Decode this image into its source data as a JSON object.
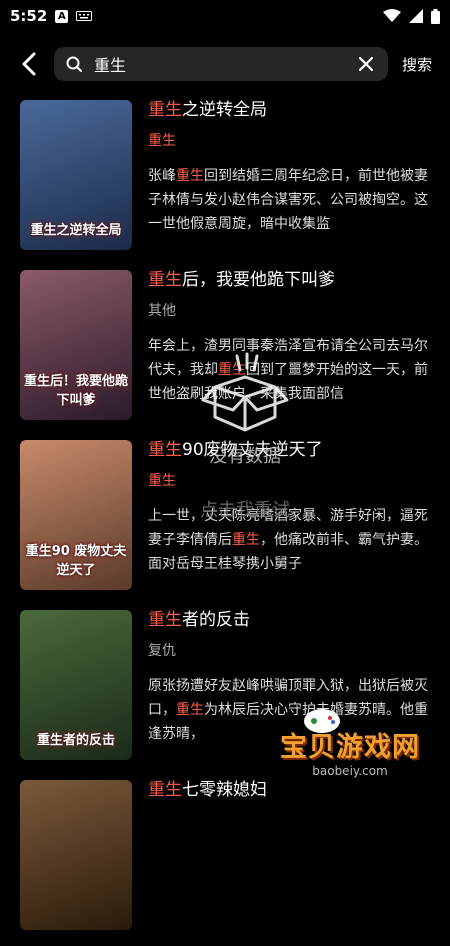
{
  "status_bar": {
    "time": "5:52",
    "icon_a": "A"
  },
  "header": {
    "search_value": "重生",
    "search_button": "搜索"
  },
  "results": [
    {
      "title_hl": "重生",
      "title_rest": "之逆转全局",
      "tag": "重生",
      "tag_red": true,
      "desc_pre": "张峰",
      "desc_hl": "重生",
      "desc_post": "回到结婚三周年纪念日，前世他被妻子林倩与发小赵伟合谋害死、公司被掏空。这一世他假意周旋，暗中收集监",
      "cover_text": "重生之逆转全局",
      "cover_colors": [
        "#4a6a9a",
        "#1a2a4a"
      ]
    },
    {
      "title_hl": "重生",
      "title_rest": "后，我要他跪下叫爹",
      "tag": "其他",
      "tag_red": false,
      "desc_pre": "年会上，渣男同事秦浩泽宣布请全公司去马尔代夫，我却",
      "desc_hl": "重生",
      "desc_post": "回到了噩梦开始的这一天，前世他盗刷我账户、采集我面部信",
      "cover_text": "重生后！我要他跪下叫爹",
      "cover_colors": [
        "#8a5a6a",
        "#2a1a2a"
      ]
    },
    {
      "title_hl": "重生",
      "title_rest": "90废物丈夫逆天了",
      "tag": "重生",
      "tag_red": true,
      "desc_pre": "上一世，丈夫陈亮嗜酒家暴、游手好闲，逼死妻子李倩倩后",
      "desc_hl": "重生",
      "desc_post": "，他痛改前非、霸气护妻。面对岳母王桂琴携小舅子",
      "cover_text": "重生90 废物丈夫逆天了",
      "cover_colors": [
        "#c88a6a",
        "#5a3a2a"
      ]
    },
    {
      "title_hl": "重生",
      "title_rest": "者的反击",
      "tag": "复仇",
      "tag_red": false,
      "desc_pre": "原张扬遭好友赵峰哄骗顶罪入狱，出狱后被灭口，",
      "desc_hl": "重生",
      "desc_post": "为林辰后决心守护未婚妻苏晴。他重逢苏晴，",
      "cover_text": "重生者的反击",
      "cover_colors": [
        "#4a6a3a",
        "#1a2a1a"
      ]
    },
    {
      "title_hl": "重生",
      "title_rest": "七零辣媳妇",
      "tag": "",
      "tag_red": false,
      "desc_pre": "",
      "desc_hl": "",
      "desc_post": "",
      "cover_text": "",
      "cover_colors": [
        "#7a5a3a",
        "#2a1a0a"
      ]
    }
  ],
  "empty_state": {
    "text": "没有数据",
    "retry": "点击我重试"
  },
  "watermark": {
    "line1": "宝贝游戏网",
    "line2": "baobeiy.com"
  },
  "colors": {
    "highlight": "#ff5e4a",
    "background": "#000000",
    "search_bg": "#262626"
  }
}
